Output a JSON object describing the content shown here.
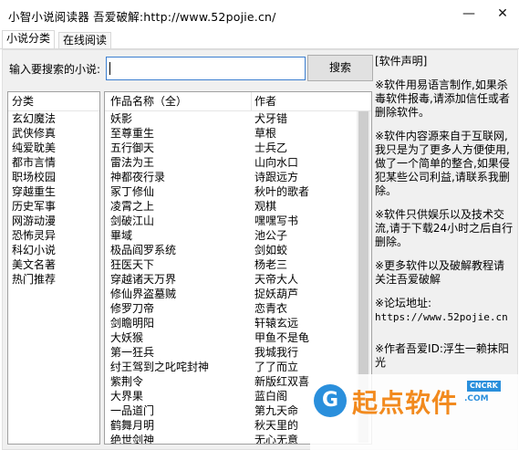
{
  "window": {
    "title": "小智小说阅读器  吾爱破解:http://www.52pojie.cn/",
    "minimize_glyph": "—",
    "close_glyph": "✕"
  },
  "tabs": [
    {
      "label": "小说分类",
      "active": true
    },
    {
      "label": "在线阅读",
      "active": false
    }
  ],
  "search": {
    "label": "输入要搜索的小说:",
    "value": "",
    "button_label": "搜索"
  },
  "categories": {
    "header": "分类",
    "items": [
      "玄幻魔法",
      "武侠修真",
      "纯爱耽美",
      "都市言情",
      "职场校园",
      "穿越重生",
      "历史军事",
      "网游动漫",
      "恐怖灵异",
      "科幻小说",
      "美文名著",
      "热门推荐"
    ]
  },
  "novels": {
    "columns": [
      "作品名称（全）",
      "作者"
    ],
    "rows": [
      [
        "妖影",
        "犬牙错"
      ],
      [
        "至尊重生",
        "草根"
      ],
      [
        "五行御天",
        "士兵乙"
      ],
      [
        "雷法为王",
        "山向水口"
      ],
      [
        "神都夜行录",
        "诗跟远方"
      ],
      [
        "冢丁修仙",
        "秋叶的歌者"
      ],
      [
        "凌霄之上",
        "观棋"
      ],
      [
        "剑破江山",
        "嘿嘿写书"
      ],
      [
        "畢域",
        "池公子"
      ],
      [
        "极品阎罗系统",
        "剑如蛟"
      ],
      [
        "狂医天下",
        "杨老三"
      ],
      [
        "穿越诸天万界",
        "天帝大人"
      ],
      [
        "修仙界盗墓贼",
        "捉妖葫芦"
      ],
      [
        "修罗刀帝",
        "恋青衣"
      ],
      [
        "剑瞻明阳",
        "轩辕玄远"
      ],
      [
        "大妖猴",
        "甲鱼不是龟"
      ],
      [
        "第一狂兵",
        "我城我行"
      ],
      [
        "纣王驾到之叱咤封神",
        "了了而立"
      ],
      [
        "紫荆令",
        "新版红双喜"
      ],
      [
        "大界果",
        "蓝白阁"
      ],
      [
        "一品道门",
        "第九天命"
      ],
      [
        "鹤舞月明",
        "秋天里的"
      ],
      [
        "绝世剑神",
        "无心无意"
      ]
    ]
  },
  "notice": {
    "paragraphs": [
      "[软件声明]",
      "※软件用易语言制作,如果杀毒软件报毒,请添加信任或者删除软件。",
      "※软件内容源来自于互联网,我只是为了更多人方便使用,做了一个简单的整合,如果侵犯某些公司利益,请联系我删除。",
      "※软件只供娱乐以及技术交流,请于下载24小时之后自行删除。",
      "※更多软件以及破解教程请关注吾爱破解",
      "※论坛地址:",
      "https://www.52pojie.cn",
      "※作者吾爱ID:浮生一赖抹阳光"
    ]
  },
  "watermark": {
    "text": "起点软件",
    "badge": "CNCRK",
    "sub": ".COM",
    "color": "#f28a1e",
    "accent": "#2a8fdc"
  }
}
